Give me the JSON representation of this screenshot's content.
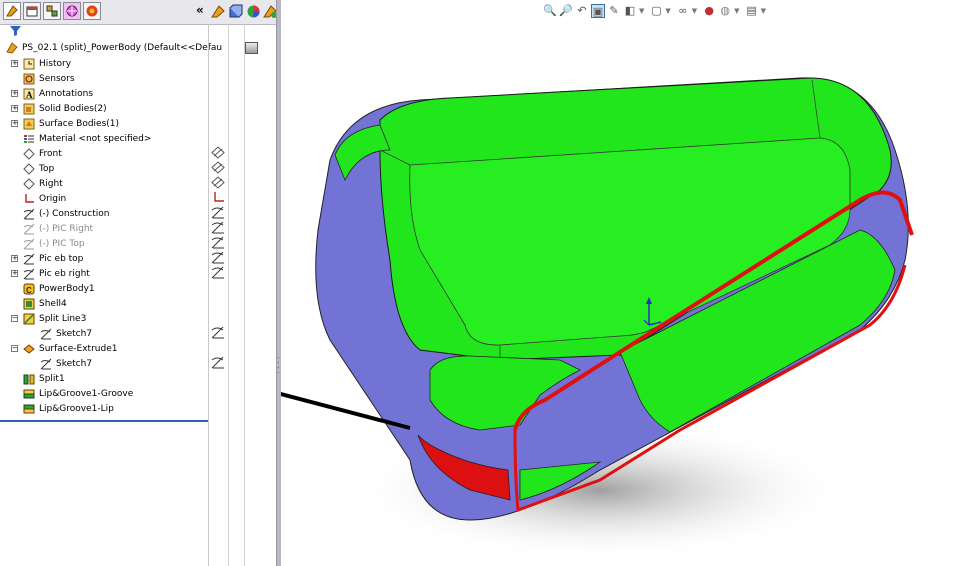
{
  "tabs": [
    "feature-manager",
    "property-manager",
    "configuration-manager",
    "dimxpert-manager",
    "display-manager"
  ],
  "collapse_glyph": "«",
  "filter_icon": "filter-icon",
  "tree": {
    "root": "PS_02.1 (split)_PowerBody  (Default<<Defau",
    "items": [
      {
        "label": "History",
        "icon": "history-icon"
      },
      {
        "label": "Sensors",
        "icon": "sensors-icon"
      },
      {
        "label": "Annotations",
        "icon": "annotations-icon"
      },
      {
        "label": "Solid Bodies(2)",
        "icon": "solid-bodies-icon"
      },
      {
        "label": "Surface Bodies(1)",
        "icon": "surface-bodies-icon"
      },
      {
        "label": "Material <not specified>",
        "icon": "material-icon"
      },
      {
        "label": "Front",
        "icon": "plane-icon"
      },
      {
        "label": "Top",
        "icon": "plane-icon"
      },
      {
        "label": "Right",
        "icon": "plane-icon"
      },
      {
        "label": "Origin",
        "icon": "origin-icon"
      },
      {
        "label": "(-) Construction",
        "icon": "sketch-icon"
      },
      {
        "label": "(-) PIC Right",
        "icon": "sketch-icon"
      },
      {
        "label": "(-) PIC Top",
        "icon": "sketch-icon"
      },
      {
        "label": "Pic eb top",
        "icon": "sketch-icon"
      },
      {
        "label": "Pic eb right",
        "icon": "sketch-icon"
      },
      {
        "label": "PowerBody1",
        "icon": "powerbody-icon"
      },
      {
        "label": "Shell4",
        "icon": "shell-icon"
      },
      {
        "label": "Split Line3",
        "icon": "split-line-icon"
      },
      {
        "label": "Sketch7",
        "icon": "sketch-icon"
      },
      {
        "label": "Surface-Extrude1",
        "icon": "surface-extrude-icon"
      },
      {
        "label": "Sketch7",
        "icon": "sketch-icon"
      },
      {
        "label": "Split1",
        "icon": "split-icon"
      },
      {
        "label": "Lip&Groove1-Groove",
        "icon": "lip-groove-icon"
      },
      {
        "label": "Lip&Groove1-Lip",
        "icon": "lip-groove-icon"
      }
    ]
  },
  "view_toolbar": [
    "zoom-to-fit-icon",
    "zoom-to-area-icon",
    "previous-view-icon",
    "section-view-icon",
    "dynamic-annotation-icon",
    "view-orientation-icon",
    "display-style-icon",
    "hide-show-icon",
    "edit-appearance-icon",
    "apply-scene-icon",
    "view-settings-icon"
  ],
  "colors": {
    "green": "#22e61c",
    "blue": "#7878d8",
    "red": "#e11010",
    "tree_border": "#3060b0"
  }
}
